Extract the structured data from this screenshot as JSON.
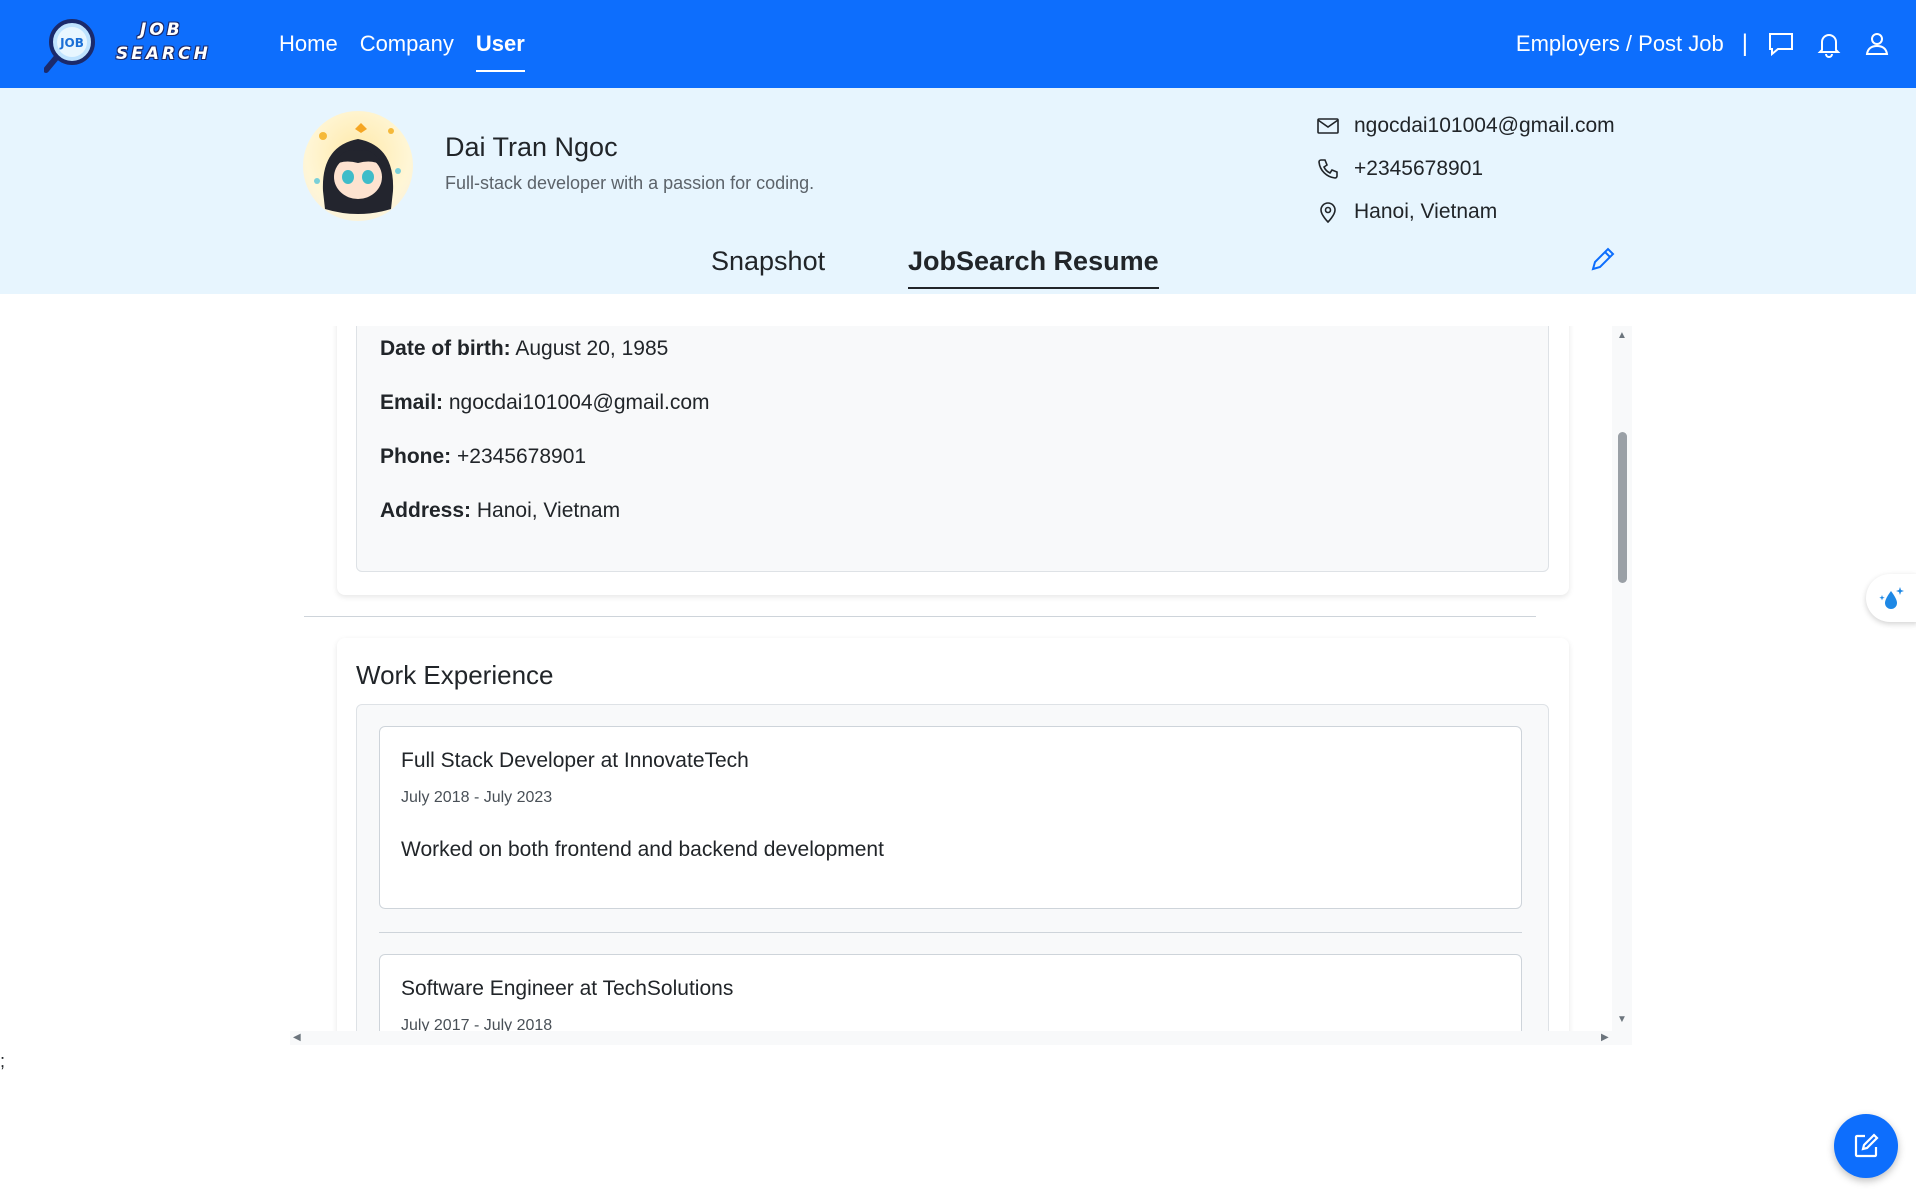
{
  "brand": {
    "logo_top": "JOB",
    "logo_bottom": "SEARCH",
    "logo_badge": "JOB"
  },
  "nav": {
    "links": [
      {
        "label": "Home",
        "active": false
      },
      {
        "label": "Company",
        "active": false
      },
      {
        "label": "User",
        "active": true
      }
    ],
    "employers_label": "Employers / Post Job",
    "separator": "|",
    "icons": [
      "chat-icon",
      "bell-icon",
      "user-icon"
    ]
  },
  "profile": {
    "name": "Dai Tran Ngoc",
    "tagline": "Full-stack developer with a passion for coding.",
    "email": "ngocdai101004@gmail.com",
    "phone": "+2345678901",
    "location": "Hanoi, Vietnam"
  },
  "tabs": [
    {
      "label": "Snapshot",
      "active": false
    },
    {
      "label": "JobSearch Resume",
      "active": true
    }
  ],
  "personal_info": {
    "dob_label": "Date of birth:",
    "dob_value": "August 20, 1985",
    "email_label": "Email:",
    "email_value": "ngocdai101004@gmail.com",
    "phone_label": "Phone:",
    "phone_value": "+2345678901",
    "address_label": "Address:",
    "address_value": "Hanoi, Vietnam"
  },
  "work_experience": {
    "title": "Work Experience",
    "jobs": [
      {
        "title": "Full Stack Developer at InnovateTech",
        "dates": "July 2018 - July 2023",
        "description": "Worked on both frontend and backend development"
      },
      {
        "title": "Software Engineer at TechSolutions",
        "dates": "July 2017 - July 2018",
        "description": ""
      }
    ]
  },
  "stray_text": ";",
  "colors": {
    "primary": "#0d6efd",
    "band": "#e7f5fe"
  }
}
